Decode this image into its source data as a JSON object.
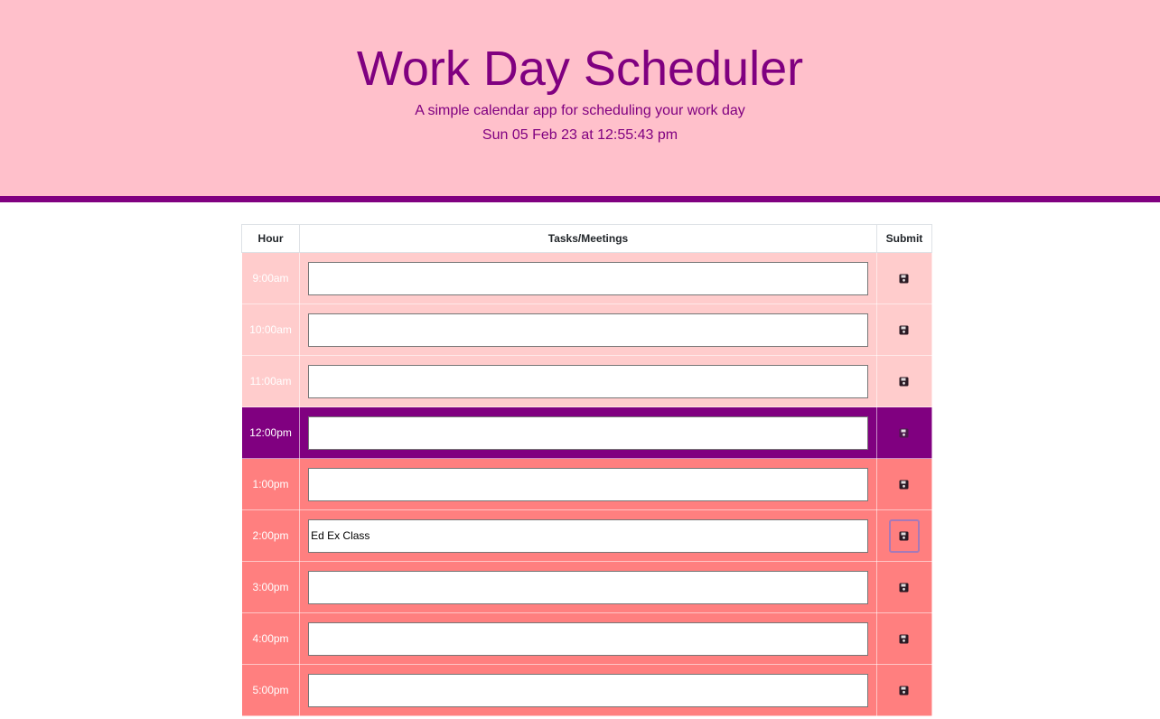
{
  "header": {
    "title": "Work Day Scheduler",
    "subtitle": "A simple calendar app for scheduling your work day",
    "datetime": "Sun 05 Feb 23 at 12:55:43 pm"
  },
  "table": {
    "columns": [
      "Hour",
      "Tasks/Meetings",
      "Submit"
    ],
    "rows": [
      {
        "hour": "9:00am",
        "task": "",
        "state": "past"
      },
      {
        "hour": "10:00am",
        "task": "",
        "state": "past"
      },
      {
        "hour": "11:00am",
        "task": "",
        "state": "past"
      },
      {
        "hour": "12:00pm",
        "task": "",
        "state": "present"
      },
      {
        "hour": "1:00pm",
        "task": "",
        "state": "future"
      },
      {
        "hour": "2:00pm",
        "task": "Ed Ex Class",
        "state": "future"
      },
      {
        "hour": "3:00pm",
        "task": "",
        "state": "future"
      },
      {
        "hour": "4:00pm",
        "task": "",
        "state": "future"
      },
      {
        "hour": "5:00pm",
        "task": "",
        "state": "future"
      }
    ],
    "save_icon": "save-floppy-icon"
  },
  "colors": {
    "header_bg": "#ffc0cb",
    "accent": "#800080",
    "past": "#ffcccc",
    "present": "#800080",
    "future": "#ff7f7f"
  }
}
